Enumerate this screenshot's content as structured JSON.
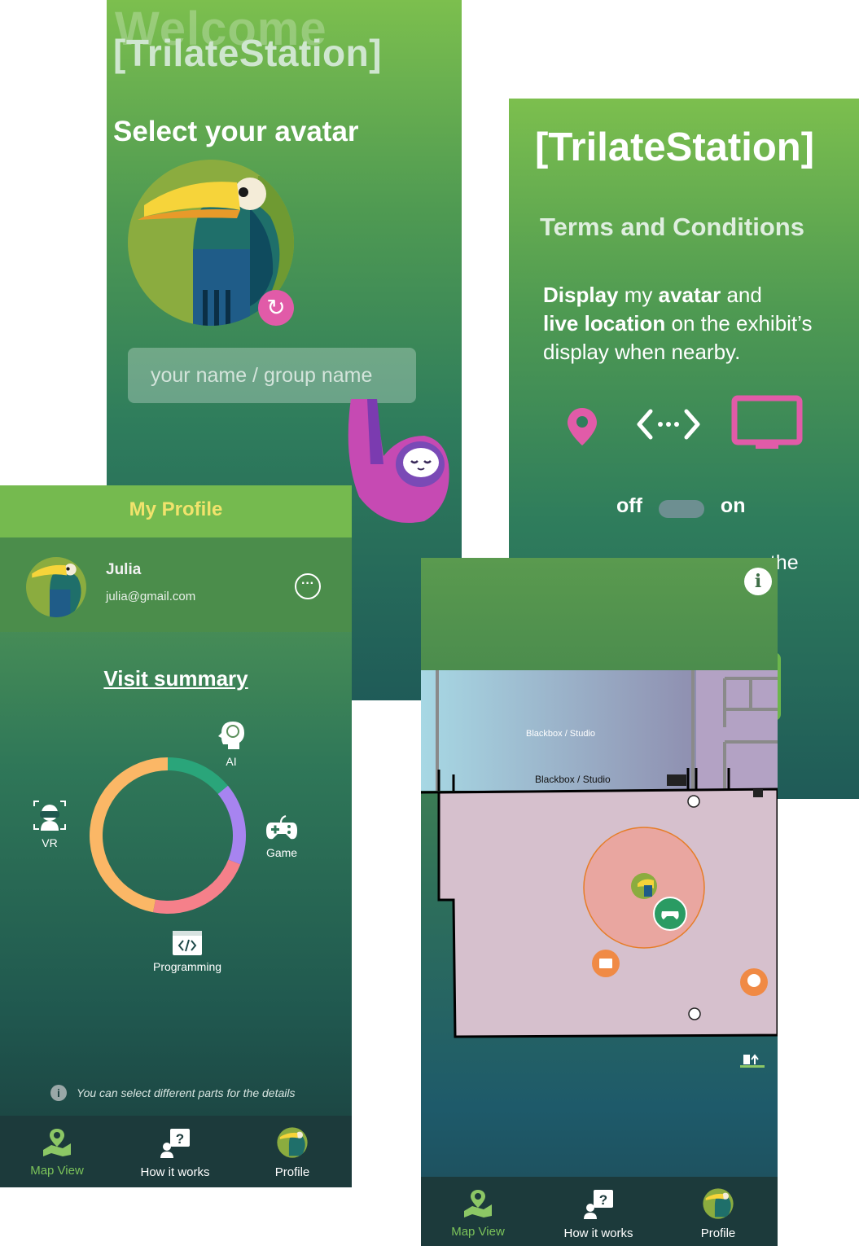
{
  "welcome": {
    "ghost_title": "Welcome",
    "brand": "[TrilateStation]",
    "select_avatar": "Select your avatar",
    "name_placeholder": "your name / group name"
  },
  "terms": {
    "brand": "[TrilateStation]",
    "title": "Terms and Conditions",
    "desc_bold1": "Display",
    "desc_t1": " my ",
    "desc_bold2": "avatar",
    "desc_t2": " and",
    "desc_bold3": "live location",
    "desc_t3": " on the exhibit’s display when nearby.",
    "toggle_off": "off",
    "toggle_on": "on",
    "truncated_text": "n the",
    "toggle_state": "off"
  },
  "profile": {
    "title": "My Profile",
    "user_name": "Julia",
    "user_email": "julia@gmail.com",
    "visit_title": "Visit summary",
    "hint": "You can select different parts for the details"
  },
  "chart_data": {
    "type": "pie",
    "donut": true,
    "categories": [
      "AI",
      "Game",
      "Programming",
      "VR"
    ],
    "values": [
      14,
      17,
      22,
      47
    ],
    "colors": [
      "#2aa57a",
      "#a784f0",
      "#f5808a",
      "#fbb766"
    ],
    "title": "Visit summary"
  },
  "map": {
    "room_upper": "Blackbox / Studio",
    "room_label": "Blackbox / Studio",
    "info_icon": "i"
  },
  "nav": {
    "map_view": "Map View",
    "how_it_works": "How it works",
    "profile": "Profile",
    "active": "map_view"
  }
}
